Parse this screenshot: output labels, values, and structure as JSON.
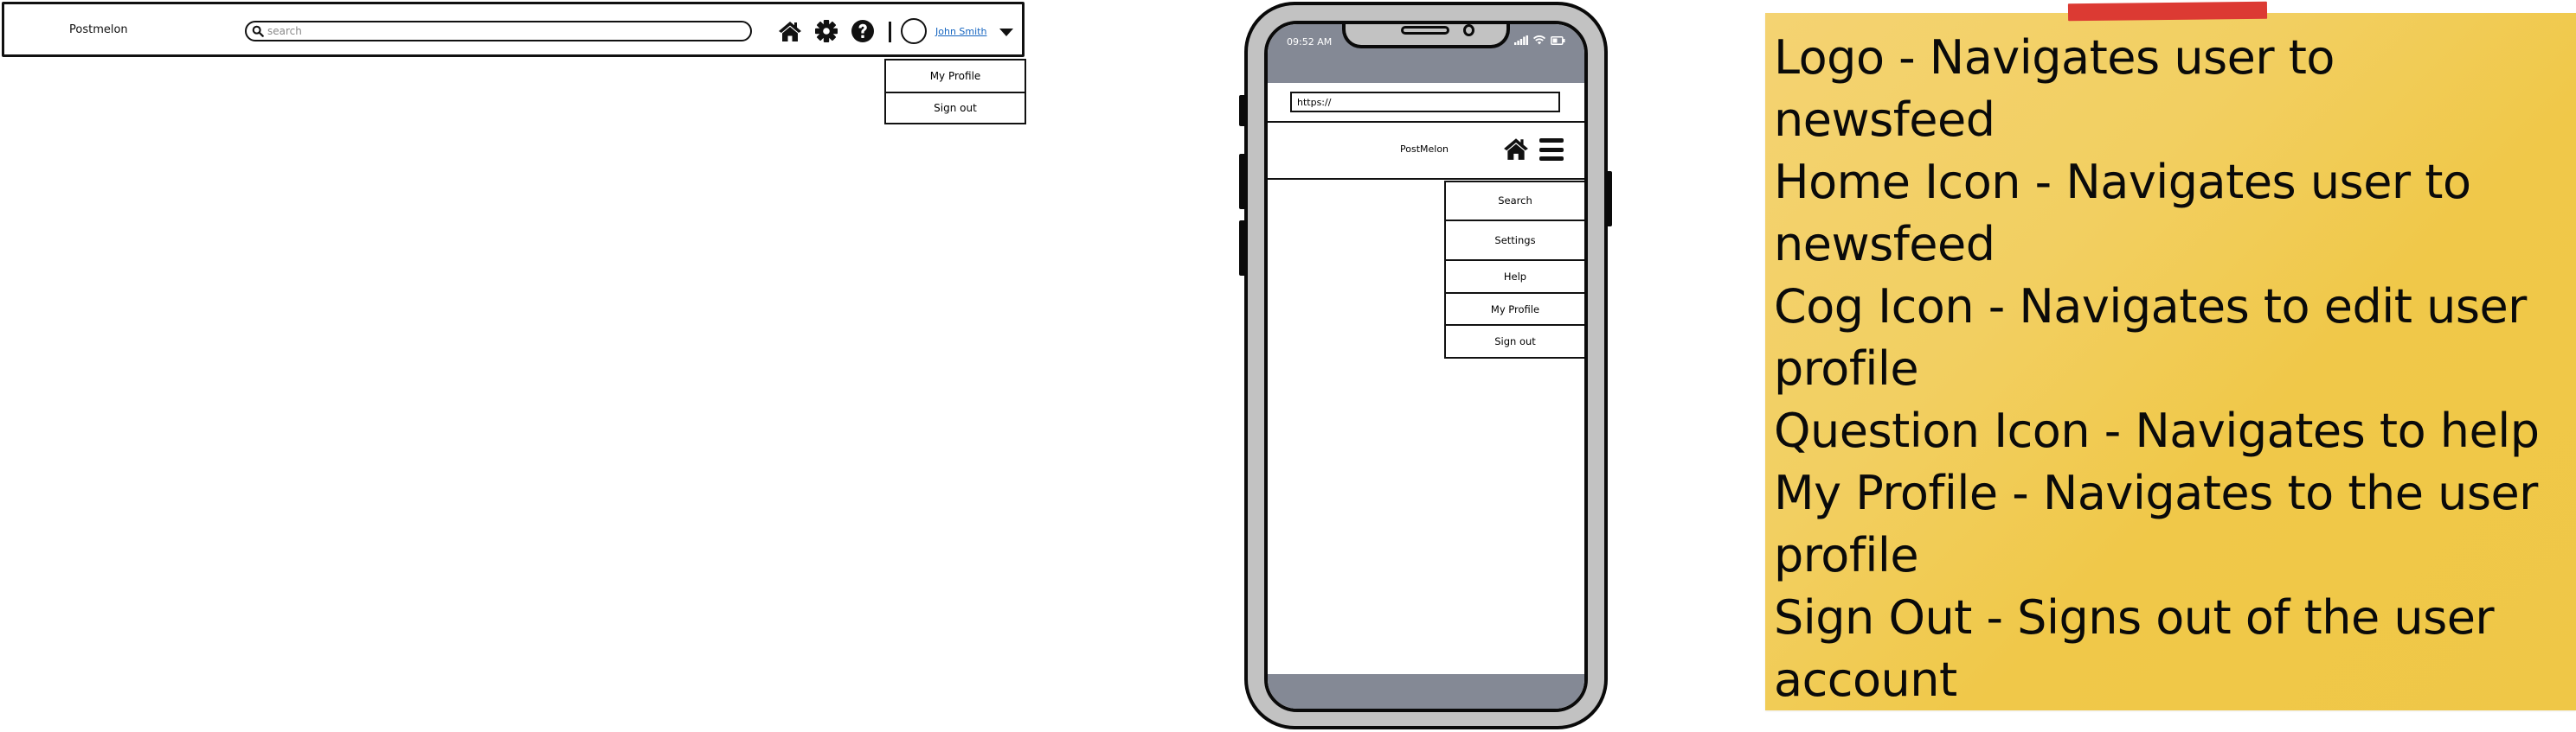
{
  "desktop_header": {
    "logo": "Postmelon",
    "search_placeholder": "search",
    "icons": [
      "home-icon",
      "cog-icon",
      "question-icon"
    ],
    "user_name": "John Smith",
    "dropdown": [
      {
        "label": "My Profile"
      },
      {
        "label": "Sign out"
      }
    ]
  },
  "mobile": {
    "status_time": "09:52 AM",
    "url_value": "https://",
    "logo": "PostMelon",
    "icons": [
      "home-icon",
      "hamburger-menu-icon"
    ],
    "dropdown": [
      {
        "label": "Search"
      },
      {
        "label": "Settings"
      },
      {
        "label": "Help"
      },
      {
        "label": "My Profile"
      },
      {
        "label": "Sign out"
      }
    ],
    "colors": {
      "status_bar": "#848995",
      "frame": "#c2c2c2"
    }
  },
  "sticky_note": {
    "color": "#f2cf61",
    "tape_color": "#dc3a33",
    "lines": [
      "Logo - Navigates user to newsfeed",
      "Home Icon - Navigates user to newsfeed",
      "Cog Icon - Navigates to edit user profile",
      "Question Icon - Navigates to help",
      "My Profile - Navigates to the user profile",
      "Sign Out - Signs out of the user account"
    ]
  }
}
